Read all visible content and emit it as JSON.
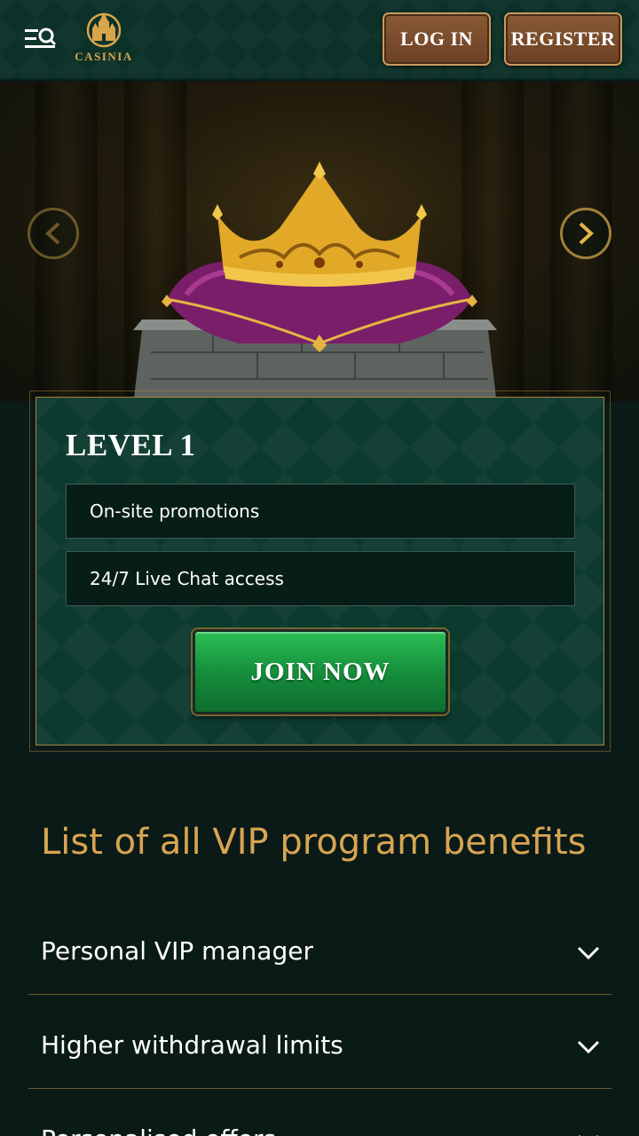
{
  "header": {
    "logo_text": "CASINIA",
    "login_label": "LOG IN",
    "register_label": "REGISTER"
  },
  "hero": {
    "level_title": "LEVEL 1",
    "perks": [
      "On-site promotions",
      "24/7 Live Chat access"
    ],
    "join_label": "JOIN NOW"
  },
  "benefits": {
    "title": "List of all VIP program benefits",
    "items": [
      "Personal VIP manager",
      "Higher withdrawal limits",
      "Personalised offers"
    ]
  },
  "colors": {
    "accent_gold": "#d9a452",
    "header_bg": "#0c3128",
    "card_bg": "#0d3a2e",
    "join_green": "#1fa548",
    "page_bg": "#0a1a17"
  },
  "icons": [
    "menu-search-icon",
    "castle-logo-icon",
    "chevron-left-icon",
    "chevron-right-icon",
    "crown-image",
    "chevron-down-icon"
  ]
}
